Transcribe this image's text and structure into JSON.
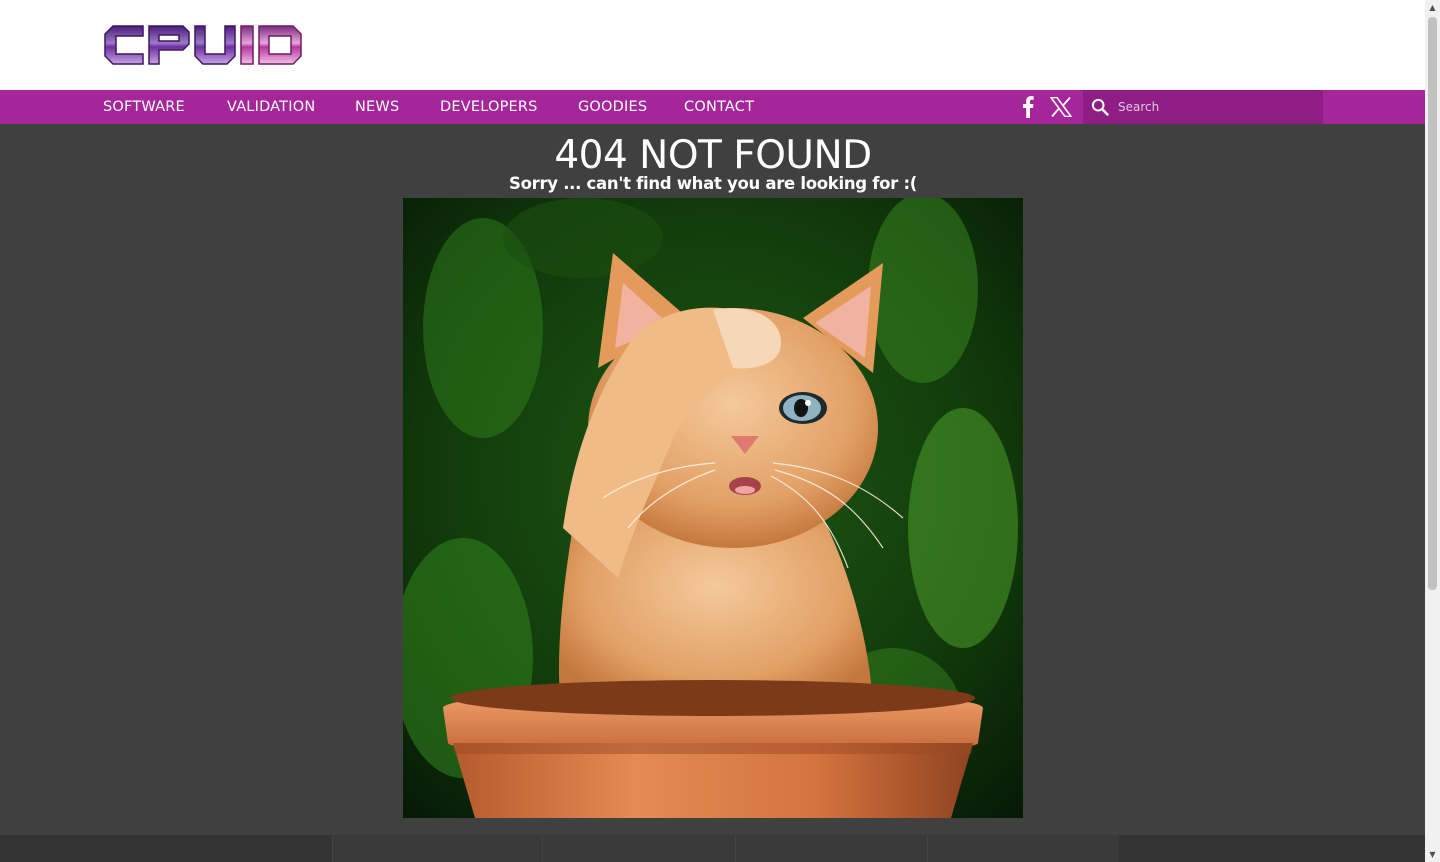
{
  "logo": {
    "text": "CPUID"
  },
  "nav": {
    "items": [
      {
        "label": "SOFTWARE"
      },
      {
        "label": "VALIDATION"
      },
      {
        "label": "NEWS"
      },
      {
        "label": "DEVELOPERS"
      },
      {
        "label": "GOODIES"
      },
      {
        "label": "CONTACT"
      }
    ],
    "social": [
      {
        "icon": "facebook-icon"
      },
      {
        "icon": "x-twitter-icon"
      }
    ]
  },
  "search": {
    "placeholder": "Search",
    "value": "",
    "icon": "search-icon"
  },
  "main": {
    "title": "404 NOT FOUND",
    "subtitle": "Sorry ... can't find what you are looking for :("
  },
  "colors": {
    "nav_bg": "#a5259a",
    "search_bg": "#8e1d84",
    "page_bg": "#404040",
    "logo_purple": "#6a2a9a"
  },
  "scrollbar": {
    "up_arrow": "▲",
    "down_arrow": "▼"
  }
}
